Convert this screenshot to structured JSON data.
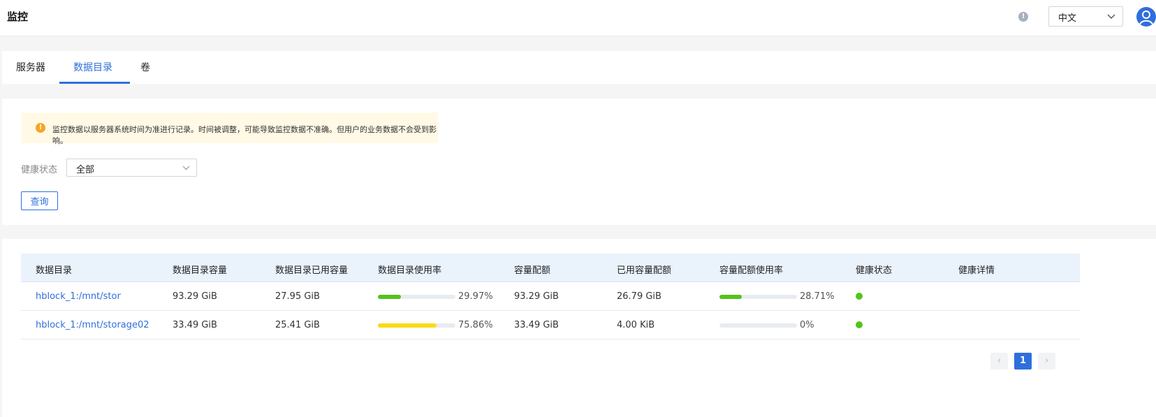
{
  "app": {
    "title": "监控"
  },
  "header": {
    "language": "中文",
    "info_icon": "info-icon",
    "avatar_icon": "user-icon"
  },
  "tabs": [
    {
      "label": "服务器",
      "active": false
    },
    {
      "label": "数据目录",
      "active": true
    },
    {
      "label": "卷",
      "active": false
    }
  ],
  "notice": {
    "text": "监控数据以服务器系统时间为准进行记录。时间被调整，可能导致监控数据不准确。但用户的业务数据不会受到影响。"
  },
  "filter": {
    "label": "健康状态",
    "value": "全部",
    "query_label": "查询"
  },
  "table": {
    "columns": [
      "数据目录",
      "数据目录容量",
      "数据目录已用容量",
      "数据目录使用率",
      "容量配额",
      "已用容量配额",
      "容量配额使用率",
      "健康状态",
      "健康详情"
    ],
    "rows": [
      {
        "dir": "hblock_1:/mnt/stor",
        "capacity": "93.29 GiB",
        "used": "27.95 GiB",
        "usage_pct": "29.97%",
        "usage_fraction": 0.2997,
        "quota": "93.29 GiB",
        "quota_used": "26.79 GiB",
        "quota_pct": "28.71%",
        "quota_fraction": 0.2871,
        "health_color": "#52c41a",
        "detail": ""
      },
      {
        "dir": "hblock_1:/mnt/storage02",
        "capacity": "33.49 GiB",
        "used": "25.41 GiB",
        "usage_pct": "75.86%",
        "usage_fraction": 0.7586,
        "quota": "33.49 GiB",
        "quota_used": "4.00 KiB",
        "quota_pct": "0%",
        "quota_fraction": 0,
        "health_color": "#52c41a",
        "detail": ""
      }
    ]
  },
  "bar_colors": {
    "normal": "#52c41a",
    "warning": "#fadb14"
  },
  "pagination": {
    "current": "1",
    "prev": "‹",
    "next": "›"
  }
}
